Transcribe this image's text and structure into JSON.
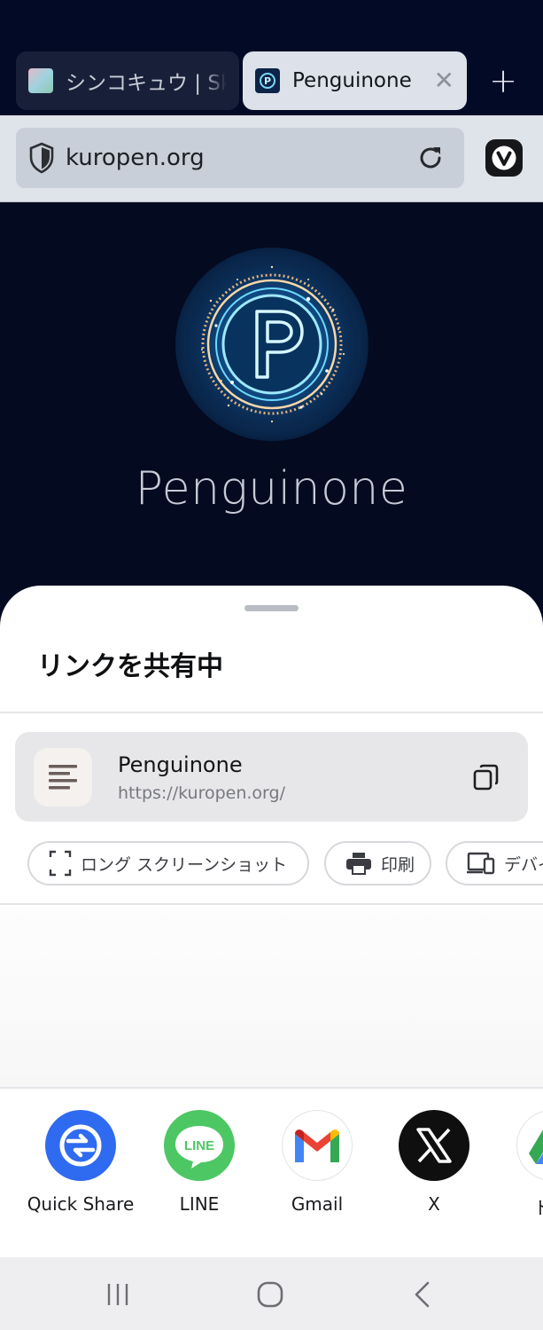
{
  "browser": {
    "tabs": [
      {
        "title": "シンコキュウ | Sk",
        "active": false,
        "favicon": "gradient-square-favicon"
      },
      {
        "title": "Penguinone",
        "active": true,
        "favicon": "penguinone-favicon"
      }
    ],
    "new_tab_icon": "plus-icon",
    "address_bar": {
      "url": "kuropen.org",
      "security_icon": "shield-icon",
      "reload_icon": "reload-icon"
    },
    "menu_icon": "vivaldi-icon"
  },
  "page": {
    "logo_icon": "penguinone-logo",
    "site_name": "Penguinone"
  },
  "share_sheet": {
    "title": "リンクを共有中",
    "link": {
      "title": "Penguinone",
      "url": "https://kuropen.org/",
      "copy_icon": "copy-icon"
    },
    "actions": [
      {
        "label": "ロング スクリーンショット",
        "icon": "long-screenshot-icon"
      },
      {
        "label": "印刷",
        "icon": "printer-icon"
      },
      {
        "label": "デバイ",
        "icon": "devices-icon"
      }
    ],
    "apps": [
      {
        "label": "Quick Share",
        "icon": "quick-share-icon",
        "color": "#2f6bf0"
      },
      {
        "label": "LINE",
        "icon": "line-icon",
        "color": "#4cc764"
      },
      {
        "label": "Gmail",
        "icon": "gmail-icon",
        "color": "#ffffff"
      },
      {
        "label": "X",
        "icon": "x-icon",
        "color": "#0f0f0f"
      },
      {
        "label": "ドラ",
        "icon": "drive-icon",
        "color": "#ffffff"
      }
    ]
  },
  "nav_bar": {
    "recents_icon": "recents-icon",
    "home_icon": "home-icon",
    "back_icon": "back-icon"
  }
}
